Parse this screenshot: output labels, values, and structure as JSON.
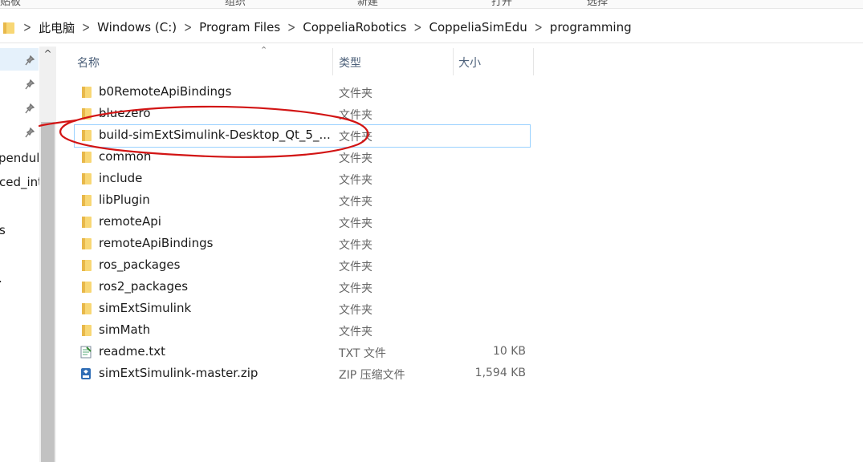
{
  "ribbon": {
    "tabs": [
      "贴板",
      "组织",
      "新建",
      "打开",
      "选择"
    ]
  },
  "address_bar": {
    "crumbs": [
      "此电脑",
      "Windows (C:)",
      "Program Files",
      "CoppeliaRobotics",
      "CoppeliaSimEdu",
      "programming"
    ]
  },
  "nav_pane": {
    "labels": [
      "pendul",
      "ced_int",
      "s",
      "."
    ]
  },
  "columns": {
    "name": "名称",
    "type": "类型",
    "size": "大小"
  },
  "files": [
    {
      "name": "b0RemoteApiBindings",
      "type": "文件夹",
      "size": "",
      "icon": "folder-icon"
    },
    {
      "name": "bluezero",
      "type": "文件夹",
      "size": "",
      "icon": "folder-icon"
    },
    {
      "name": "build-simExtSimulink-Desktop_Qt_5_...",
      "type": "文件夹",
      "size": "",
      "icon": "folder-icon"
    },
    {
      "name": "common",
      "type": "文件夹",
      "size": "",
      "icon": "folder-icon"
    },
    {
      "name": "include",
      "type": "文件夹",
      "size": "",
      "icon": "folder-icon"
    },
    {
      "name": "libPlugin",
      "type": "文件夹",
      "size": "",
      "icon": "folder-icon"
    },
    {
      "name": "remoteApi",
      "type": "文件夹",
      "size": "",
      "icon": "folder-icon"
    },
    {
      "name": "remoteApiBindings",
      "type": "文件夹",
      "size": "",
      "icon": "folder-icon"
    },
    {
      "name": "ros_packages",
      "type": "文件夹",
      "size": "",
      "icon": "folder-icon"
    },
    {
      "name": "ros2_packages",
      "type": "文件夹",
      "size": "",
      "icon": "folder-icon"
    },
    {
      "name": "simExtSimulink",
      "type": "文件夹",
      "size": "",
      "icon": "folder-icon"
    },
    {
      "name": "simMath",
      "type": "文件夹",
      "size": "",
      "icon": "folder-icon"
    },
    {
      "name": "readme.txt",
      "type": "TXT 文件",
      "size": "10 KB",
      "icon": "text-file-icon"
    },
    {
      "name": "simExtSimulink-master.zip",
      "type": "ZIP 压缩文件",
      "size": "1,594 KB",
      "icon": "zip-file-icon"
    }
  ],
  "selected_row": 2,
  "colors": {
    "folder": "#f8d775",
    "folder_dark": "#e8b84a",
    "annotation": "#d21414",
    "selection_border": "#99d1ff"
  }
}
